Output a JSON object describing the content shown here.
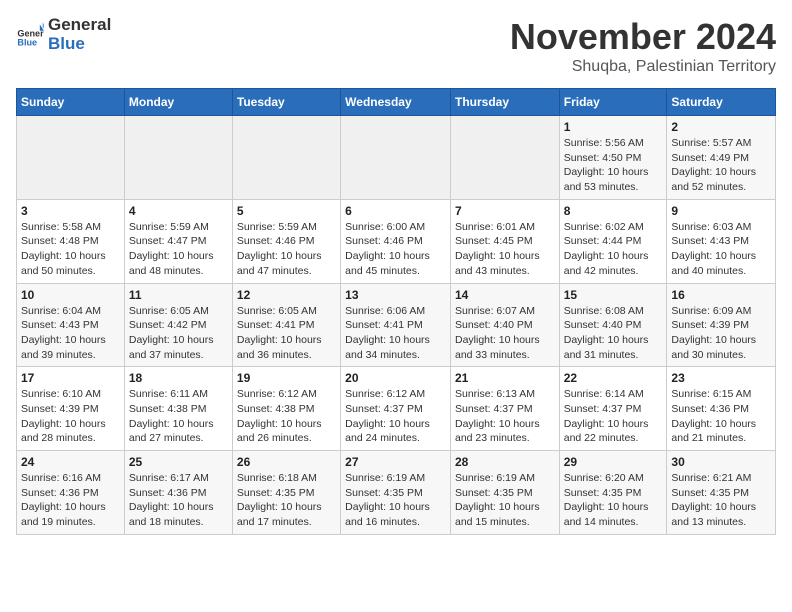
{
  "header": {
    "logo_general": "General",
    "logo_blue": "Blue",
    "month_title": "November 2024",
    "location": "Shuqba, Palestinian Territory"
  },
  "weekdays": [
    "Sunday",
    "Monday",
    "Tuesday",
    "Wednesday",
    "Thursday",
    "Friday",
    "Saturday"
  ],
  "weeks": [
    [
      {
        "day": "",
        "info": ""
      },
      {
        "day": "",
        "info": ""
      },
      {
        "day": "",
        "info": ""
      },
      {
        "day": "",
        "info": ""
      },
      {
        "day": "",
        "info": ""
      },
      {
        "day": "1",
        "info": "Sunrise: 5:56 AM\nSunset: 4:50 PM\nDaylight: 10 hours\nand 53 minutes."
      },
      {
        "day": "2",
        "info": "Sunrise: 5:57 AM\nSunset: 4:49 PM\nDaylight: 10 hours\nand 52 minutes."
      }
    ],
    [
      {
        "day": "3",
        "info": "Sunrise: 5:58 AM\nSunset: 4:48 PM\nDaylight: 10 hours\nand 50 minutes."
      },
      {
        "day": "4",
        "info": "Sunrise: 5:59 AM\nSunset: 4:47 PM\nDaylight: 10 hours\nand 48 minutes."
      },
      {
        "day": "5",
        "info": "Sunrise: 5:59 AM\nSunset: 4:46 PM\nDaylight: 10 hours\nand 47 minutes."
      },
      {
        "day": "6",
        "info": "Sunrise: 6:00 AM\nSunset: 4:46 PM\nDaylight: 10 hours\nand 45 minutes."
      },
      {
        "day": "7",
        "info": "Sunrise: 6:01 AM\nSunset: 4:45 PM\nDaylight: 10 hours\nand 43 minutes."
      },
      {
        "day": "8",
        "info": "Sunrise: 6:02 AM\nSunset: 4:44 PM\nDaylight: 10 hours\nand 42 minutes."
      },
      {
        "day": "9",
        "info": "Sunrise: 6:03 AM\nSunset: 4:43 PM\nDaylight: 10 hours\nand 40 minutes."
      }
    ],
    [
      {
        "day": "10",
        "info": "Sunrise: 6:04 AM\nSunset: 4:43 PM\nDaylight: 10 hours\nand 39 minutes."
      },
      {
        "day": "11",
        "info": "Sunrise: 6:05 AM\nSunset: 4:42 PM\nDaylight: 10 hours\nand 37 minutes."
      },
      {
        "day": "12",
        "info": "Sunrise: 6:05 AM\nSunset: 4:41 PM\nDaylight: 10 hours\nand 36 minutes."
      },
      {
        "day": "13",
        "info": "Sunrise: 6:06 AM\nSunset: 4:41 PM\nDaylight: 10 hours\nand 34 minutes."
      },
      {
        "day": "14",
        "info": "Sunrise: 6:07 AM\nSunset: 4:40 PM\nDaylight: 10 hours\nand 33 minutes."
      },
      {
        "day": "15",
        "info": "Sunrise: 6:08 AM\nSunset: 4:40 PM\nDaylight: 10 hours\nand 31 minutes."
      },
      {
        "day": "16",
        "info": "Sunrise: 6:09 AM\nSunset: 4:39 PM\nDaylight: 10 hours\nand 30 minutes."
      }
    ],
    [
      {
        "day": "17",
        "info": "Sunrise: 6:10 AM\nSunset: 4:39 PM\nDaylight: 10 hours\nand 28 minutes."
      },
      {
        "day": "18",
        "info": "Sunrise: 6:11 AM\nSunset: 4:38 PM\nDaylight: 10 hours\nand 27 minutes."
      },
      {
        "day": "19",
        "info": "Sunrise: 6:12 AM\nSunset: 4:38 PM\nDaylight: 10 hours\nand 26 minutes."
      },
      {
        "day": "20",
        "info": "Sunrise: 6:12 AM\nSunset: 4:37 PM\nDaylight: 10 hours\nand 24 minutes."
      },
      {
        "day": "21",
        "info": "Sunrise: 6:13 AM\nSunset: 4:37 PM\nDaylight: 10 hours\nand 23 minutes."
      },
      {
        "day": "22",
        "info": "Sunrise: 6:14 AM\nSunset: 4:37 PM\nDaylight: 10 hours\nand 22 minutes."
      },
      {
        "day": "23",
        "info": "Sunrise: 6:15 AM\nSunset: 4:36 PM\nDaylight: 10 hours\nand 21 minutes."
      }
    ],
    [
      {
        "day": "24",
        "info": "Sunrise: 6:16 AM\nSunset: 4:36 PM\nDaylight: 10 hours\nand 19 minutes."
      },
      {
        "day": "25",
        "info": "Sunrise: 6:17 AM\nSunset: 4:36 PM\nDaylight: 10 hours\nand 18 minutes."
      },
      {
        "day": "26",
        "info": "Sunrise: 6:18 AM\nSunset: 4:35 PM\nDaylight: 10 hours\nand 17 minutes."
      },
      {
        "day": "27",
        "info": "Sunrise: 6:19 AM\nSunset: 4:35 PM\nDaylight: 10 hours\nand 16 minutes."
      },
      {
        "day": "28",
        "info": "Sunrise: 6:19 AM\nSunset: 4:35 PM\nDaylight: 10 hours\nand 15 minutes."
      },
      {
        "day": "29",
        "info": "Sunrise: 6:20 AM\nSunset: 4:35 PM\nDaylight: 10 hours\nand 14 minutes."
      },
      {
        "day": "30",
        "info": "Sunrise: 6:21 AM\nSunset: 4:35 PM\nDaylight: 10 hours\nand 13 minutes."
      }
    ]
  ]
}
